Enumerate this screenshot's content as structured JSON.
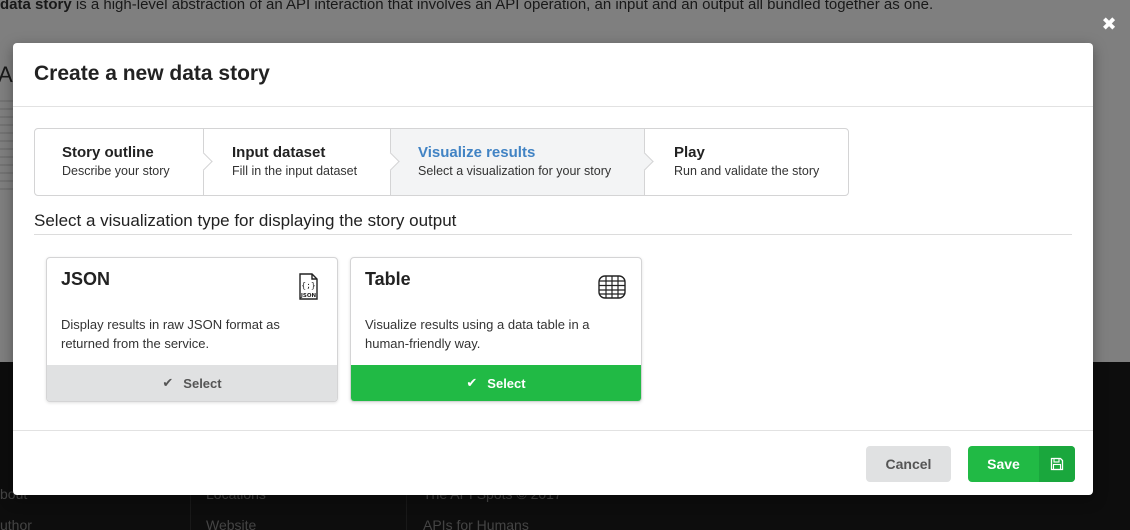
{
  "background": {
    "intro_bold": "data story",
    "intro_rest": " is a high-level abstraction of an API interaction that involves an API operation, an input and an output all bundled together as one.",
    "heading_fragment": "A",
    "footer": {
      "col1_a": "bout",
      "col1_b": "uthor",
      "col2_a": "Locations",
      "col2_b": "Website",
      "col3_a": "The API Spots © 2017",
      "col3_b": "APIs for Humans"
    }
  },
  "modal": {
    "title": "Create a new data story",
    "close_icon": "close-icon",
    "steps": [
      {
        "title": "Story outline",
        "desc": "Describe your story"
      },
      {
        "title": "Input dataset",
        "desc": "Fill in the input dataset"
      },
      {
        "title": "Visualize results",
        "desc": "Select a visualization for your story"
      },
      {
        "title": "Play",
        "desc": "Run and validate the story"
      }
    ],
    "active_step": 2,
    "section_title": "Select a visualization type for displaying the story output",
    "cards": [
      {
        "title": "JSON",
        "icon": "json-file-icon",
        "icon_text": "JSON",
        "desc": "Display results in raw JSON format as returned from the service.",
        "button": "Select",
        "selected": false
      },
      {
        "title": "Table",
        "icon": "table-grid-icon",
        "desc": "Visualize results using a data table in a human-friendly way.",
        "button": "Select",
        "selected": true
      }
    ],
    "footer": {
      "cancel": "Cancel",
      "save": "Save",
      "save_icon": "floppy-disk-icon"
    }
  },
  "colors": {
    "accent_green": "#21ba45",
    "active_step_title": "#4183c4",
    "grey_button": "#e0e1e2"
  }
}
